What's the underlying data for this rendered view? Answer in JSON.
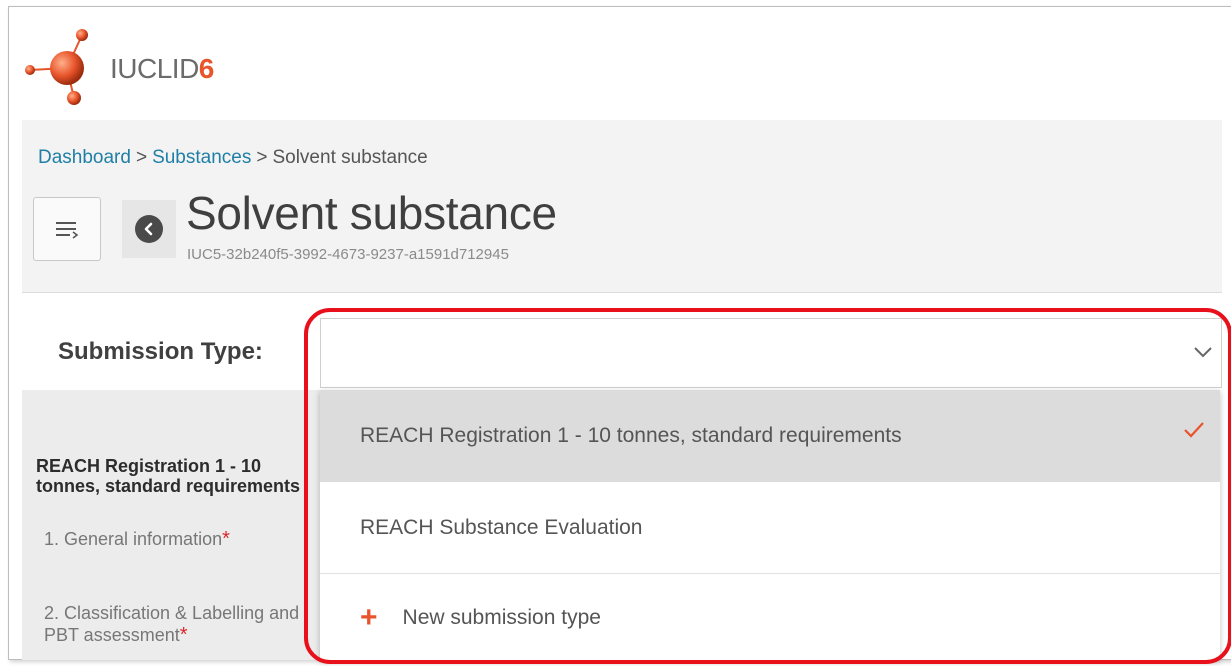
{
  "app": {
    "logo_text": "IUCLID",
    "logo_version": "6"
  },
  "breadcrumb": {
    "dashboard": "Dashboard",
    "substances": "Substances",
    "current": "Solvent substance",
    "separator": ">"
  },
  "header": {
    "title": "Solvent substance",
    "uuid": "IUC5-32b240f5-3992-4673-9237-a1591d712945"
  },
  "submission": {
    "label": "Submission Type:",
    "value": "",
    "options": [
      {
        "label": "REACH Registration 1 - 10 tonnes, standard requirements",
        "selected": true
      },
      {
        "label": "REACH Substance Evaluation",
        "selected": false
      }
    ],
    "new_label": "New submission type"
  },
  "sidebar": {
    "title": "REACH Registration 1 - 10 tonnes, standard requirements",
    "items": [
      {
        "label": "1. General information",
        "required": "*"
      },
      {
        "label": "2. Classification & Labelling and PBT assessment",
        "required": "*"
      }
    ]
  },
  "colors": {
    "accent": "#e8542b",
    "link": "#1f7fa6",
    "highlight": "#e8101a",
    "required": "#d9262b"
  }
}
